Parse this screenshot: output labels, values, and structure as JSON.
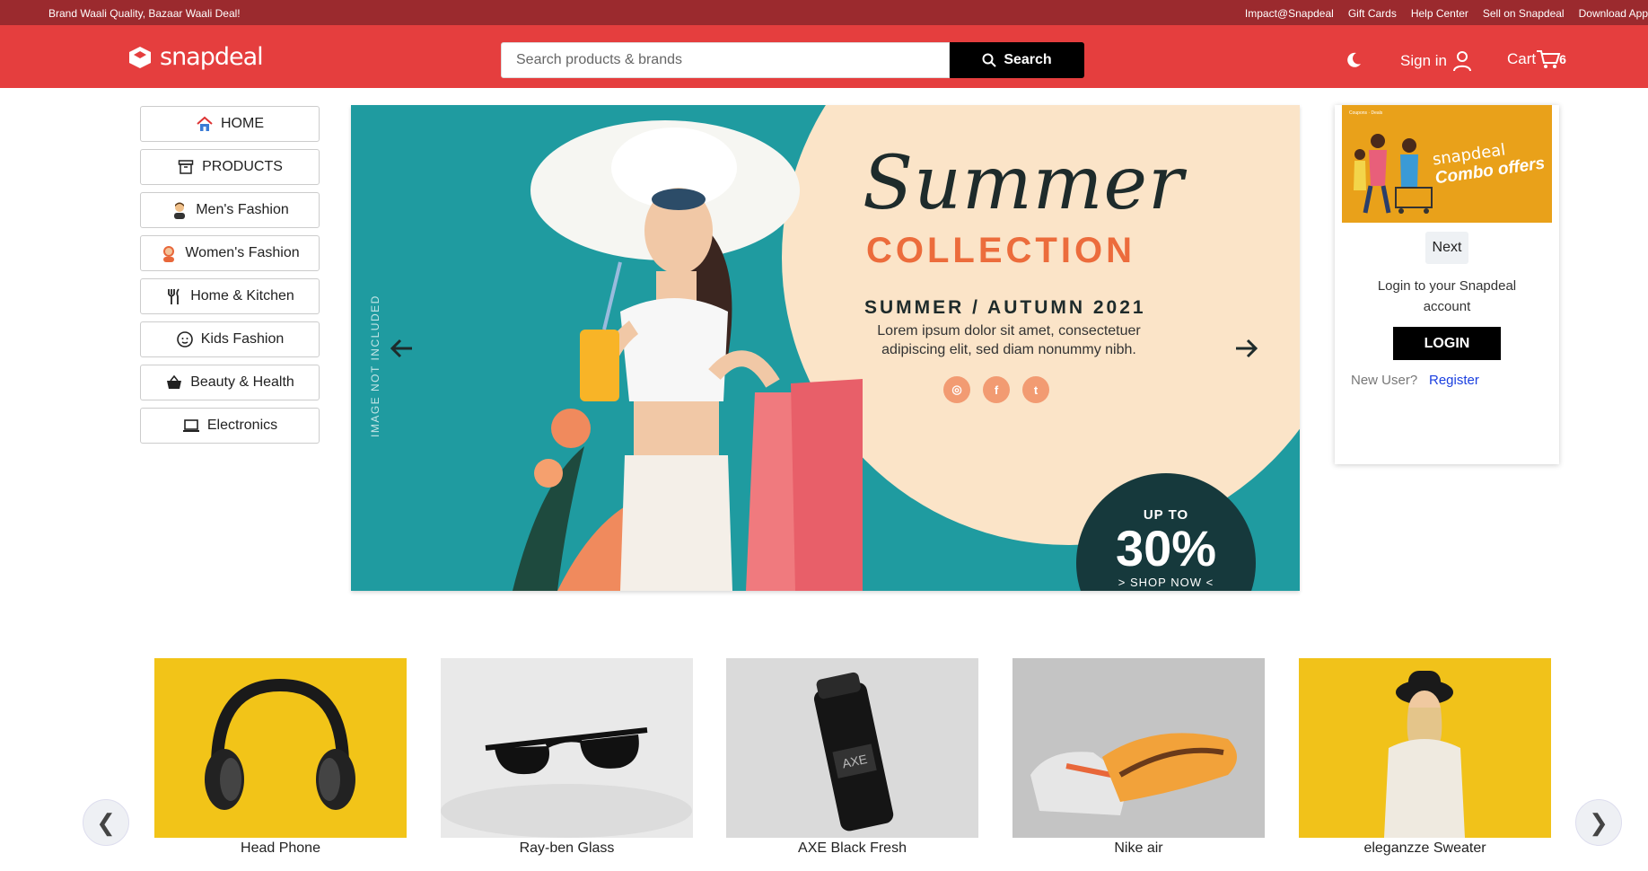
{
  "topbar": {
    "tagline": "Brand Waali Quality, Bazaar Waali Deal!",
    "links": [
      "Impact@Snapdeal",
      "Gift Cards",
      "Help Center",
      "Sell on Snapdeal",
      "Download App"
    ]
  },
  "header": {
    "logo_text": "snapdeal",
    "search_placeholder": "Search products & brands",
    "search_button": "Search",
    "signin_label": "Sign in",
    "cart_label": "Cart",
    "cart_count": "6"
  },
  "sidebar": {
    "items": [
      {
        "label": "HOME",
        "icon": "house-icon"
      },
      {
        "label": "PRODUCTS",
        "icon": "box-icon"
      },
      {
        "label": "Men's Fashion",
        "icon": "man-icon"
      },
      {
        "label": "Women's Fashion",
        "icon": "woman-icon"
      },
      {
        "label": "Home & Kitchen",
        "icon": "utensils-icon"
      },
      {
        "label": "Kids Fashion",
        "icon": "kid-icon"
      },
      {
        "label": "Beauty & Health",
        "icon": "basket-icon"
      },
      {
        "label": "Electronics",
        "icon": "laptop-icon"
      }
    ]
  },
  "banner": {
    "title_script": "Summer",
    "title_main": "COLLECTION",
    "season": "SUMMER / AUTUMN 2021",
    "body": "Lorem ipsum dolor sit amet, consectetuer adipiscing elit, sed diam nonummy nibh.",
    "badge_top": "UP TO",
    "badge_value": "30%",
    "badge_bottom": "> SHOP NOW <",
    "side_note": "IMAGE NOT INCLUDED"
  },
  "login_card": {
    "promo_line1": "snapdeal",
    "promo_line2": "Combo offers",
    "next_label": "Next",
    "message": "Login to your Snapdeal account",
    "login_button": "LOGIN",
    "new_user_label": "New User?",
    "register_label": "Register"
  },
  "products": [
    {
      "name": "Head Phone",
      "bg": "#f2c418"
    },
    {
      "name": "Ray-ben Glass",
      "bg": "#e9e9e9"
    },
    {
      "name": "AXE Black Fresh",
      "bg": "#d9d9d9"
    },
    {
      "name": "Nike air",
      "bg": "#bdbdbd"
    },
    {
      "name": "eleganzze Sweater",
      "bg": "#f1c21a"
    }
  ],
  "colors": {
    "topbar": "#9b2a2e",
    "header": "#e53e3e",
    "banner_bg": "#1f9ba0",
    "accent_orange": "#ec6c3c",
    "register_link": "#1a3fe0"
  }
}
